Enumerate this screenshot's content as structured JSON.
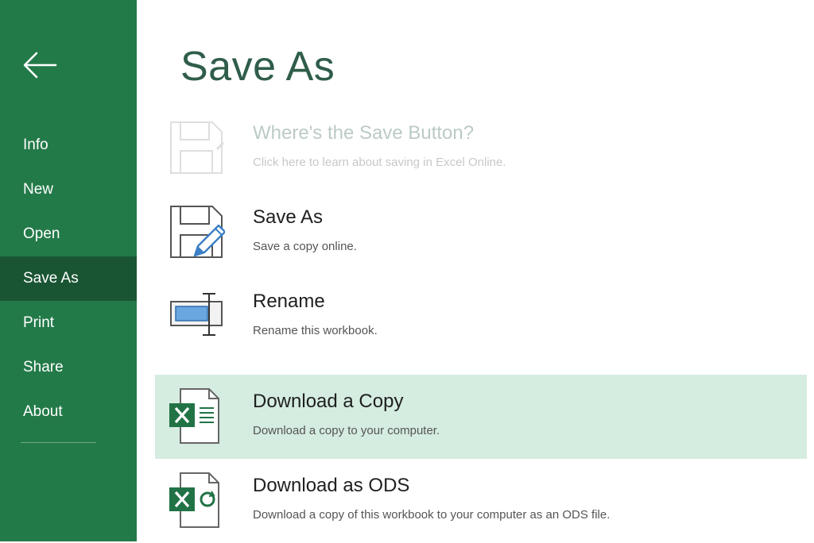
{
  "page": {
    "title": "Save As"
  },
  "sidebar": {
    "items": [
      {
        "label": "Info"
      },
      {
        "label": "New"
      },
      {
        "label": "Open"
      },
      {
        "label": "Save As",
        "active": true
      },
      {
        "label": "Print"
      },
      {
        "label": "Share"
      },
      {
        "label": "About"
      }
    ]
  },
  "options": [
    {
      "title": "Where's the Save Button?",
      "desc": "Click here to learn about saving in Excel Online.",
      "icon": "floppy-disk-icon",
      "state": "disabled"
    },
    {
      "title": "Save As",
      "desc": "Save a copy online.",
      "icon": "save-as-pencil-icon"
    },
    {
      "title": "Rename",
      "desc": "Rename this workbook.",
      "icon": "rename-icon"
    },
    {
      "title": "Download a Copy",
      "desc": "Download a copy to your computer.",
      "icon": "excel-file-icon",
      "state": "highlighted"
    },
    {
      "title": "Download as ODS",
      "desc": "Download a copy of this workbook to your computer as an ODS file.",
      "icon": "excel-ods-file-icon"
    }
  ],
  "colors": {
    "sidebar": "#237a49",
    "sidebar_active": "#1a5533",
    "highlight": "#d5ece1",
    "excel_green": "#217346",
    "accent_blue": "#3b7fc4"
  }
}
